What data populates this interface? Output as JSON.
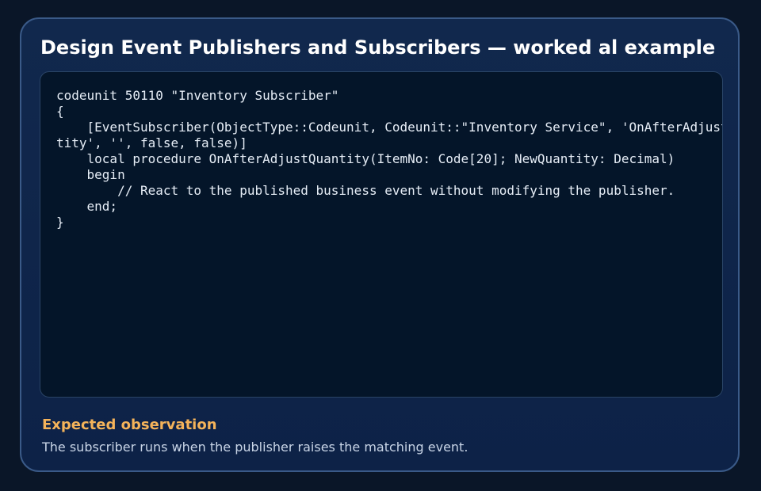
{
  "page": {
    "title": "Design Event Publishers and Subscribers — worked al example"
  },
  "code_block": {
    "lines": [
      "codeunit 50110 \"Inventory Subscriber\"",
      "{",
      "    [EventSubscriber(ObjectType::Codeunit, Codeunit::\"Inventory Service\", 'OnAfterAdjustQuan",
      "tity', '', false, false)]",
      "    local procedure OnAfterAdjustQuantity(ItemNo: Code[20]; NewQuantity: Decimal)",
      "    begin",
      "        // React to the published business event without modifying the publisher.",
      "    end;",
      "}"
    ]
  },
  "observation": {
    "heading": "Expected observation",
    "text": "The subscriber runs when the publisher raises the matching event."
  },
  "colors": {
    "background": "#0a1628",
    "card": "#11284d",
    "card_border": "#3a5a88",
    "code_background": "#041529",
    "heading_accent": "#f4b35a"
  }
}
